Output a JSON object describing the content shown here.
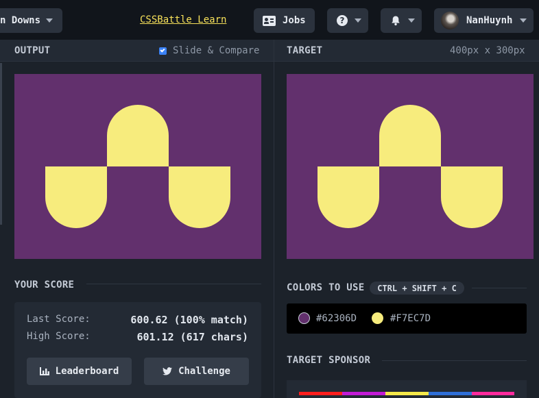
{
  "topbar": {
    "battle_menu_label": "n Downs",
    "learn_link": "CSSBattle Learn",
    "jobs_label": "Jobs",
    "username": "NanHuynh"
  },
  "output_panel": {
    "title": "OUTPUT",
    "slide_compare_label": "Slide & Compare",
    "slide_compare_checked": true
  },
  "target_panel": {
    "title": "TARGET",
    "dimensions": "400px x 300px"
  },
  "score": {
    "title": "YOUR SCORE",
    "last_label": "Last Score:",
    "last_value": "600.62 (100% match)",
    "high_label": "High Score:",
    "high_value": "601.12 (617 chars)",
    "leaderboard_label": "Leaderboard",
    "challenge_label": "Challenge"
  },
  "colors": {
    "title": "COLORS TO USE",
    "shortcut": "CTRL + SHIFT + C",
    "items": [
      {
        "hex": "#62306D"
      },
      {
        "hex": "#F7EC7D"
      }
    ]
  },
  "sponsor": {
    "title": "TARGET SPONSOR",
    "stripe_colors": [
      "#ff1e1e",
      "#c21bd6",
      "#f5e94a",
      "#2f6fd8",
      "#ff2a9d"
    ]
  },
  "icons": {
    "jobs": "id-card-icon",
    "help": "question-circle-icon",
    "notifications": "bell-icon",
    "leaderboard": "bar-chart-icon",
    "challenge": "twitter-bird-icon"
  },
  "palette": {
    "canvas_background": "#62306d",
    "shape_fill": "#f7ec7d",
    "link_color": "#f7e15a"
  }
}
